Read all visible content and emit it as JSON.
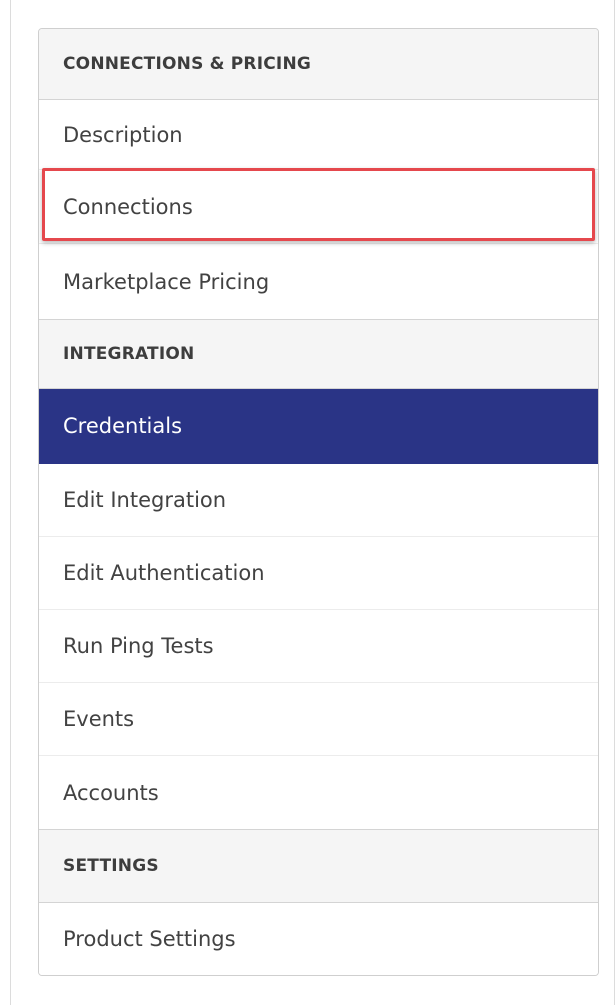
{
  "nav": {
    "sections": [
      {
        "header": "CONNECTIONS & PRICING",
        "items": [
          "Description",
          "Connections",
          "Marketplace Pricing"
        ]
      },
      {
        "header": "INTEGRATION",
        "items": [
          "Credentials",
          "Edit Integration",
          "Edit Authentication",
          "Run Ping Tests",
          "Events",
          "Accounts"
        ]
      },
      {
        "header": "SETTINGS",
        "items": [
          "Product Settings"
        ]
      }
    ],
    "active_item": "Credentials",
    "highlighted_item": "Connections"
  },
  "colors": {
    "active_background": "#2a3486",
    "highlight_border": "#e5484d",
    "section_background": "#f5f5f5"
  }
}
